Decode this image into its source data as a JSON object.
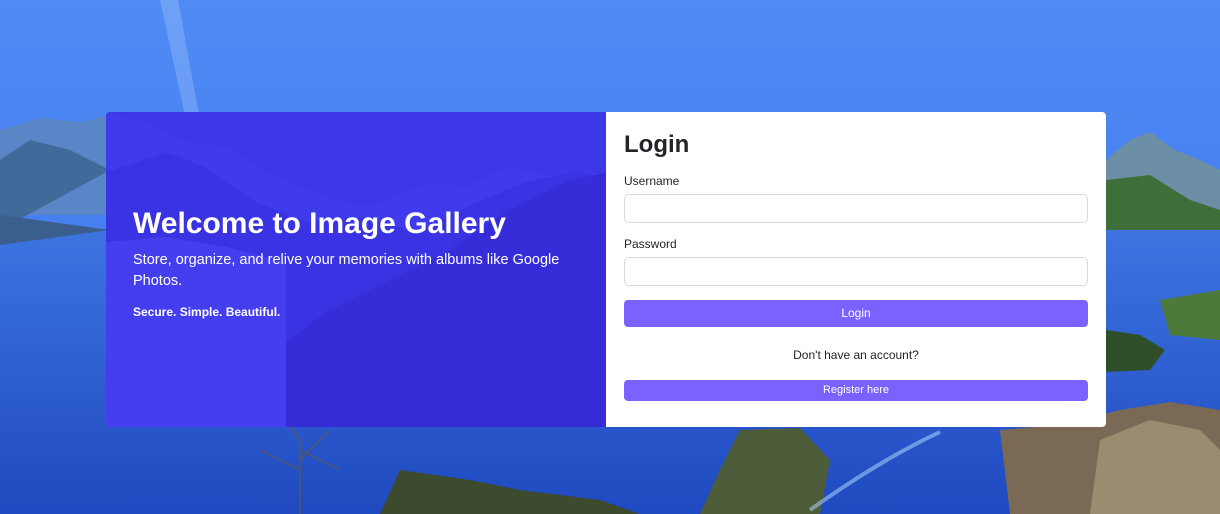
{
  "welcome": {
    "title": "Welcome to Image Gallery",
    "subtitle": "Store, organize, and relive your memories with albums like Google Photos.",
    "tagline": "Secure. Simple. Beautiful."
  },
  "login": {
    "title": "Login",
    "username_label": "Username",
    "username_value": "",
    "password_label": "Password",
    "password_value": "",
    "login_button": "Login",
    "register_prompt": "Don't have an account?",
    "register_button": "Register here"
  },
  "colors": {
    "accent": "#7b61ff",
    "welcome_overlay": "#3c28ff"
  }
}
